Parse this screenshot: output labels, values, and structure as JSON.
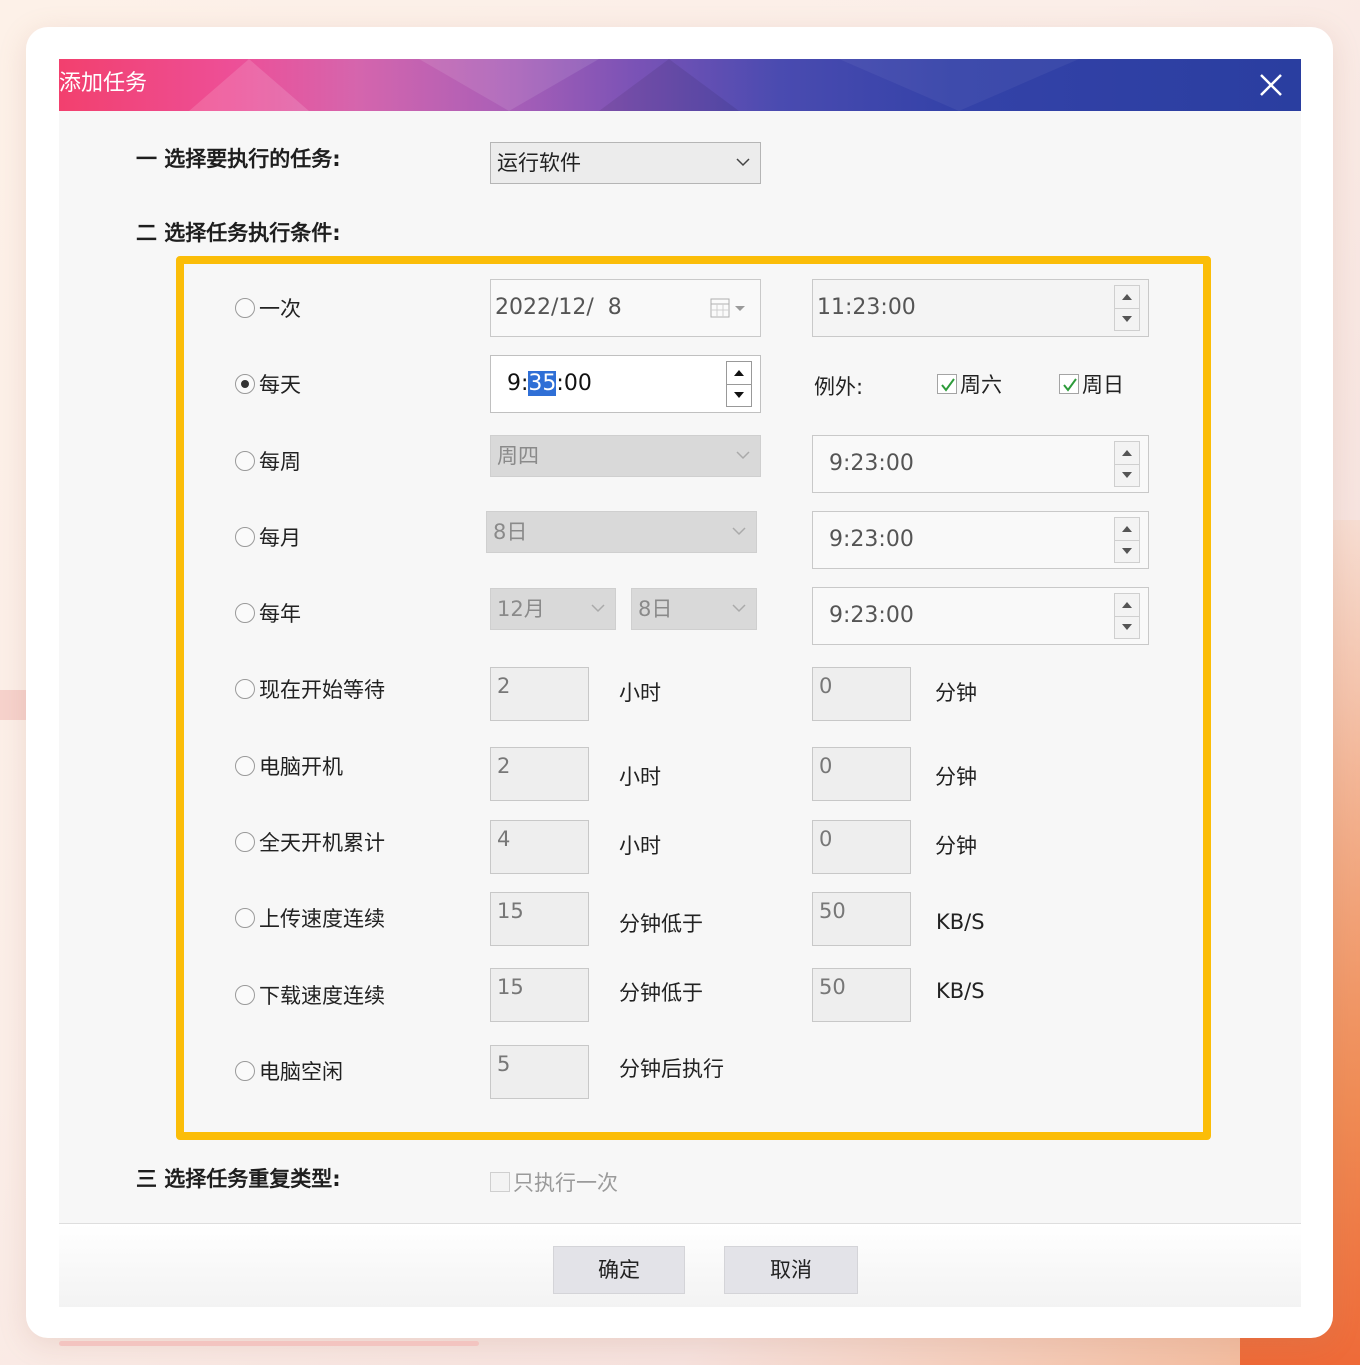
{
  "dialog": {
    "title": "添加任务",
    "close_icon": "close-icon"
  },
  "section1": {
    "label": "一 选择要执行的任务:",
    "task_select_value": "运行软件"
  },
  "section2": {
    "label": "二 选择任务执行条件:"
  },
  "conditions": {
    "once": {
      "label": "一次",
      "date": "2022/12/  8",
      "time": "11:23:00",
      "selected": false
    },
    "daily": {
      "label": "每天",
      "time_hour": "9:",
      "time_min": "35",
      "time_sec": ":00",
      "selected": true,
      "exception_label": "例外:",
      "saturday_label": "周六",
      "saturday_checked": true,
      "sunday_label": "周日",
      "sunday_checked": true
    },
    "weekly": {
      "label": "每周",
      "weekday": "周四",
      "time": "9:23:00",
      "selected": false
    },
    "monthly": {
      "label": "每月",
      "day": "8日",
      "time": "9:23:00",
      "selected": false
    },
    "yearly": {
      "label": "每年",
      "month": "12月",
      "day": "8日",
      "time": "9:23:00",
      "selected": false
    },
    "wait": {
      "label": "现在开始等待",
      "hours": "2",
      "hours_unit": "小时",
      "minutes": "0",
      "minutes_unit": "分钟",
      "selected": false
    },
    "boot": {
      "label": "电脑开机",
      "hours": "2",
      "hours_unit": "小时",
      "minutes": "0",
      "minutes_unit": "分钟",
      "selected": false
    },
    "uptime": {
      "label": "全天开机累计",
      "hours": "4",
      "hours_unit": "小时",
      "minutes": "0",
      "minutes_unit": "分钟",
      "selected": false
    },
    "upload": {
      "label": "上传速度连续",
      "minutes": "15",
      "minutes_unit": "分钟低于",
      "speed": "50",
      "speed_unit": "KB/S",
      "selected": false
    },
    "download": {
      "label": "下载速度连续",
      "minutes": "15",
      "minutes_unit": "分钟低于",
      "speed": "50",
      "speed_unit": "KB/S",
      "selected": false
    },
    "idle": {
      "label": "电脑空闲",
      "minutes": "5",
      "minutes_unit": "分钟后执行",
      "selected": false
    }
  },
  "section3": {
    "label": "三 选择任务重复类型:",
    "once_only_label": "只执行一次",
    "once_only_checked": false
  },
  "footer": {
    "ok_label": "确定",
    "cancel_label": "取消"
  },
  "colors": {
    "highlight_border": "#fbbd08",
    "selection": "#2f6fd6"
  }
}
